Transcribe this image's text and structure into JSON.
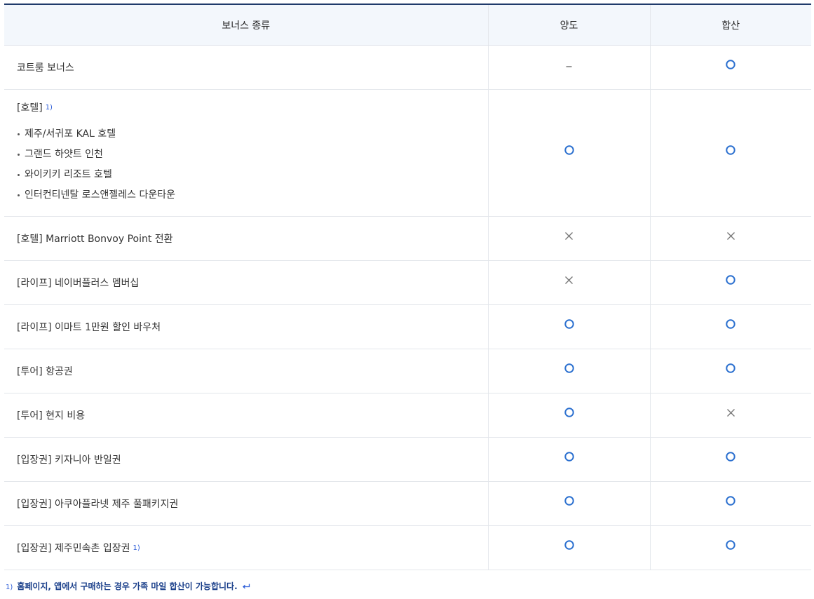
{
  "table": {
    "headers": [
      "보너스 종류",
      "양도",
      "합산"
    ],
    "rows": [
      {
        "name": "코트룸 보너스",
        "transfer": "-",
        "combine": "O"
      },
      {
        "name": "[호텔]",
        "note": "1)",
        "items": [
          "제주/서귀포 KAL 호텔",
          "그랜드 하얏트 인천",
          "와이키키 리조트 호텔",
          "인터컨티넨탈 로스앤젤레스 다운타운"
        ],
        "transfer": "O",
        "combine": "O"
      },
      {
        "name": "[호텔] Marriott Bonvoy Point 전환",
        "transfer": "X",
        "combine": "X"
      },
      {
        "name": "[라이프] 네이버플러스 멤버십",
        "transfer": "X",
        "combine": "O"
      },
      {
        "name": "[라이프] 이마트 1만원 할인 바우처",
        "transfer": "O",
        "combine": "O"
      },
      {
        "name": "[투어] 항공권",
        "transfer": "O",
        "combine": "O"
      },
      {
        "name": "[투어] 현지 비용",
        "transfer": "O",
        "combine": "X"
      },
      {
        "name": "[입장권] 키자니아 반일권",
        "transfer": "O",
        "combine": "O"
      },
      {
        "name": "[입장권] 아쿠아플라넷 제주 풀패키지권",
        "transfer": "O",
        "combine": "O"
      },
      {
        "name": "[입장권] 제주민속촌 입장권",
        "note": "1)",
        "transfer": "O",
        "combine": "O"
      }
    ]
  },
  "footnote": {
    "num": "1)",
    "text": "홈페이지, 앱에서 구매하는 경우 가족 마일 합산이 가능합니다."
  },
  "icons": {
    "available": "circle-icon",
    "unavailable": "cross-icon",
    "none": "dash-icon",
    "back": "return-arrow-icon"
  },
  "colors": {
    "header_border": "#1f3a6b",
    "header_bg": "#f3f7fc",
    "circle": "#2a6fcf",
    "cross": "#777777",
    "footnote": "#1a3f8a"
  }
}
